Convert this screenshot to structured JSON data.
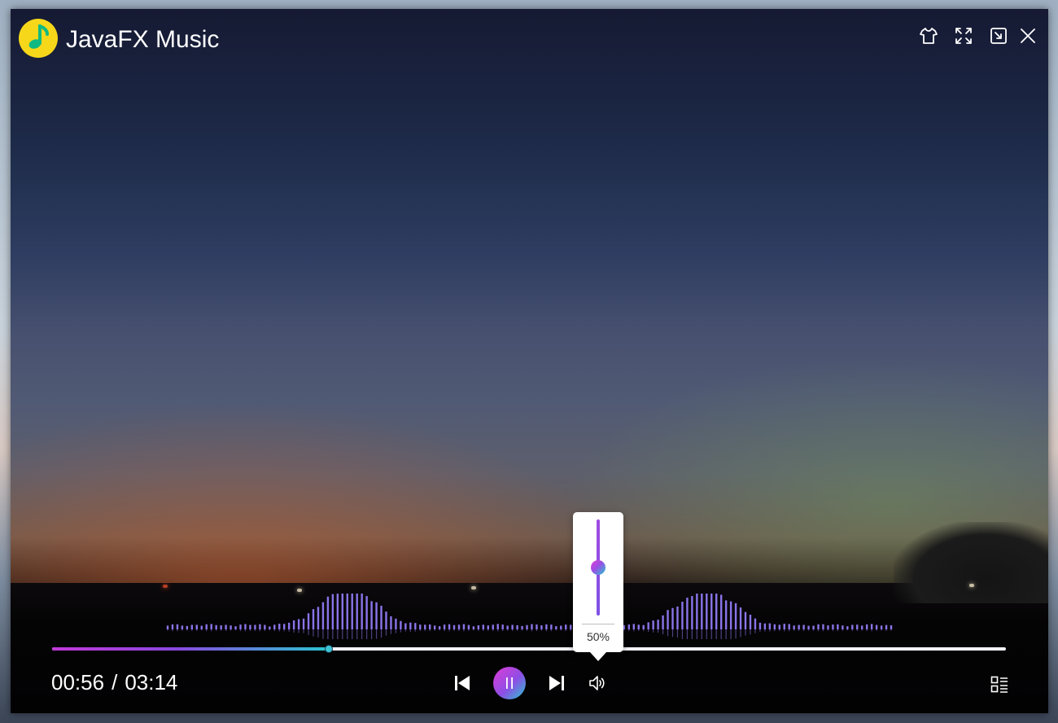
{
  "app": {
    "title": "JavaFX Music",
    "logo_icon": "music-note-icon",
    "logo_color": "#f7d71a",
    "logo_note_color": "#10b981"
  },
  "titlebar": {
    "buttons": [
      {
        "id": "skin",
        "icon": "tshirt-icon"
      },
      {
        "id": "fullscreen",
        "icon": "expand-icon"
      },
      {
        "id": "minimize",
        "icon": "minimize-to-corner-icon"
      },
      {
        "id": "close",
        "icon": "close-icon"
      }
    ]
  },
  "player": {
    "current_time": "00:56",
    "separator": "/",
    "total_time": "03:14",
    "progress_fraction": 0.29,
    "state": "playing",
    "controls": {
      "prev_icon": "skip-previous-icon",
      "play_pause_icon": "pause-icon",
      "next_icon": "skip-next-icon",
      "volume_icon": "volume-icon",
      "playlist_icon": "playlist-icon"
    }
  },
  "volume_popup": {
    "label": "50%",
    "level_fraction": 0.5
  },
  "colors": {
    "accent_start": "#c23ad9",
    "accent_mid": "#8a49e0",
    "accent_end": "#2bc6cf",
    "spectrum": "#8b74e8",
    "text": "#ffffff"
  }
}
